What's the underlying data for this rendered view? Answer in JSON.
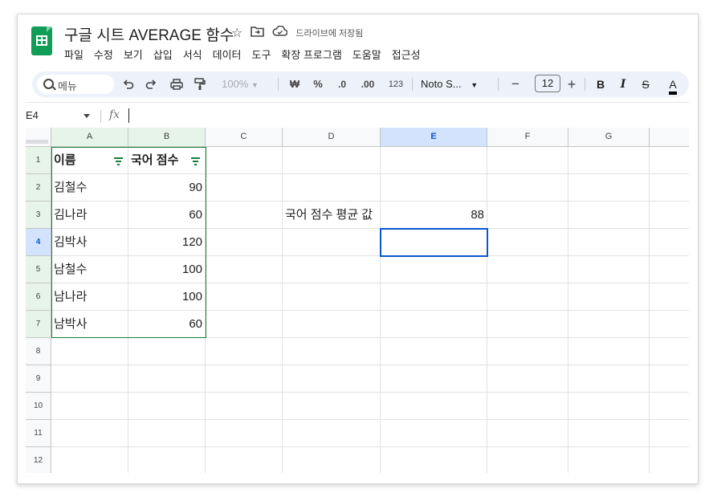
{
  "app": {
    "doc_title": "구글 시트 AVERAGE 함수",
    "save_status": "드라이브에 저장됨",
    "menu": [
      "파일",
      "수정",
      "보기",
      "삽입",
      "서식",
      "데이터",
      "도구",
      "확장 프로그램",
      "도움말",
      "접근성"
    ]
  },
  "toolbar": {
    "menu_search": "메뉴",
    "zoom": "100%",
    "currency": "₩",
    "percent": "%",
    "dec_decrease": ".0",
    "dec_increase": ".00",
    "more_formats": "123",
    "font": "Noto S...",
    "font_size": "12",
    "minus": "−",
    "plus": "+",
    "bold": "B",
    "italic": "I",
    "strike": "S",
    "text_color": "A"
  },
  "formula_bar": {
    "name_box": "E4",
    "fx": "fx",
    "formula": ""
  },
  "sheet": {
    "columns": [
      "A",
      "B",
      "C",
      "D",
      "E",
      "F",
      "G"
    ],
    "rows": [
      "1",
      "2",
      "3",
      "4",
      "5",
      "6",
      "7",
      "8",
      "9",
      "10",
      "11",
      "12"
    ],
    "header": {
      "name": "이름",
      "score": "국어 점수"
    },
    "data": [
      {
        "name": "김철수",
        "score": "90"
      },
      {
        "name": "김나라",
        "score": "60"
      },
      {
        "name": "김박사",
        "score": "120"
      },
      {
        "name": "남철수",
        "score": "100"
      },
      {
        "name": "남나라",
        "score": "100"
      },
      {
        "name": "남박사",
        "score": "60"
      }
    ],
    "avg_label": "국어 점수 평균 값",
    "avg_value": "88",
    "active_cell": "E4"
  },
  "colors": {
    "accent": "#0b57d0",
    "range": "#188038",
    "toolbar_bg": "#edf2fa",
    "logo": "#0f9d58"
  },
  "icons": [
    "star-icon",
    "move-to-folder-icon",
    "cloud-saved-icon",
    "search-icon",
    "undo-icon",
    "redo-icon",
    "print-icon",
    "paint-format-icon",
    "filter-icon"
  ]
}
